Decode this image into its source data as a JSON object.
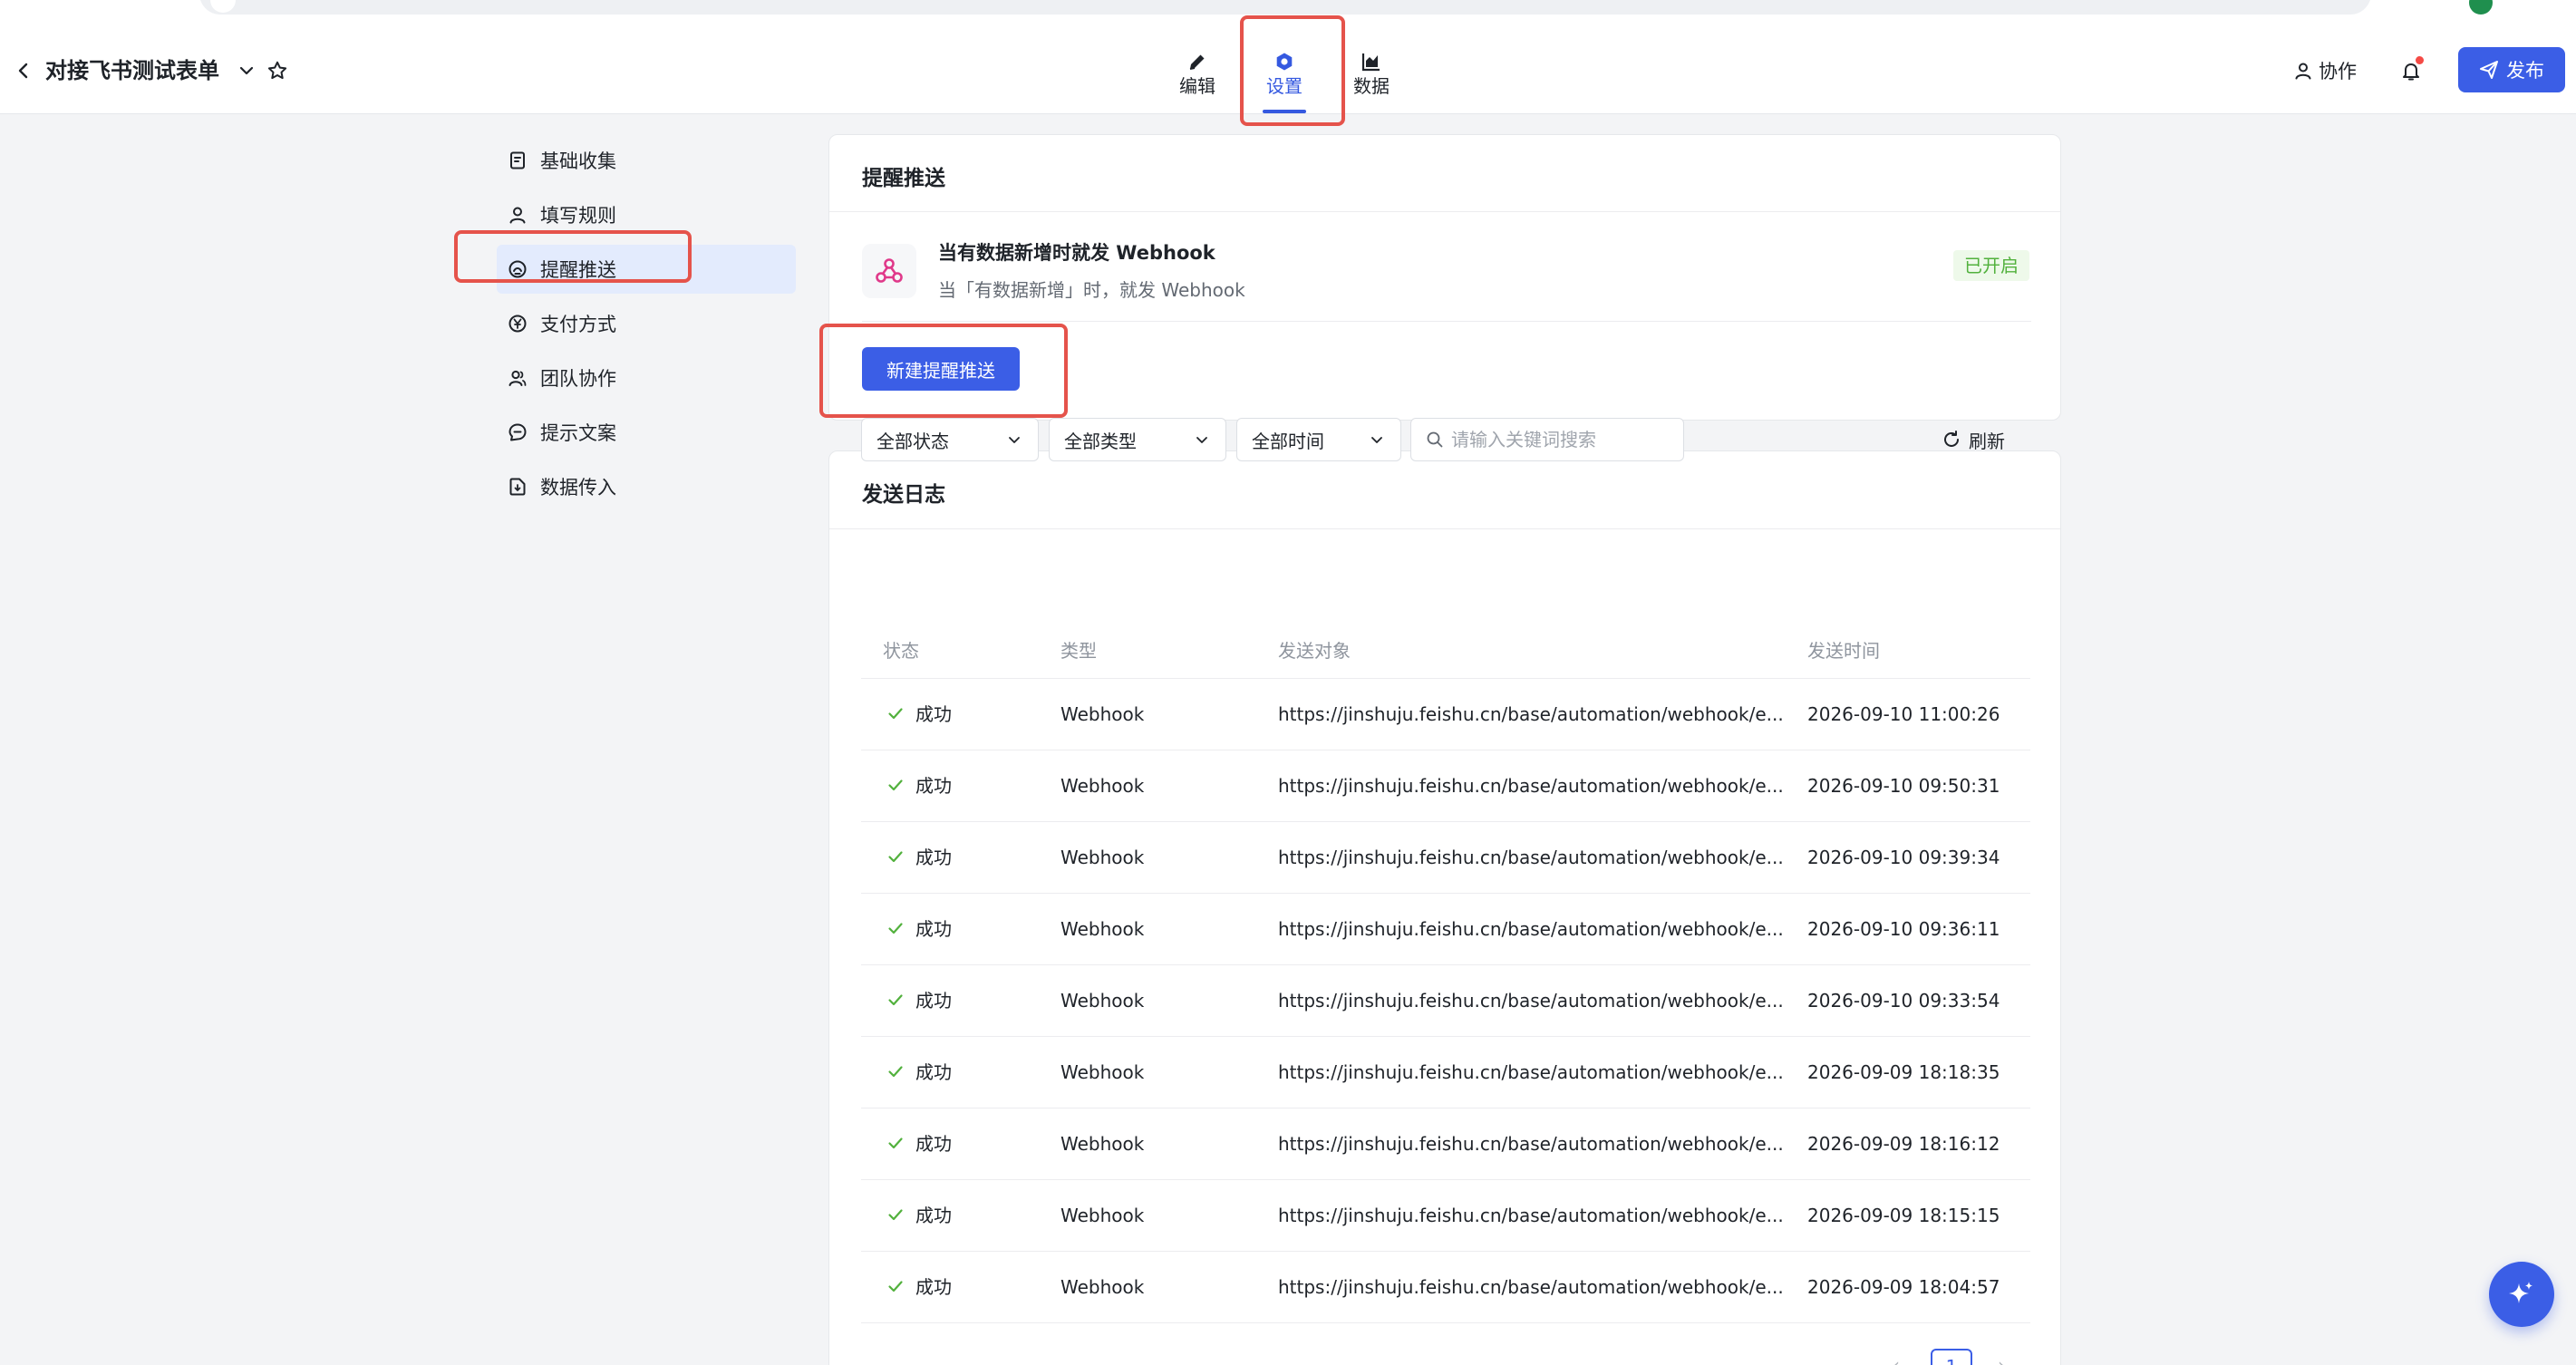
{
  "header": {
    "form_title": "对接飞书测试表单",
    "tabs": [
      {
        "label": "编辑",
        "icon": "pencil-icon"
      },
      {
        "label": "设置",
        "icon": "hexagon-settings-icon",
        "active": true
      },
      {
        "label": "数据",
        "icon": "chart-icon"
      }
    ],
    "collab_label": "协作",
    "publish_label": "发布"
  },
  "sidebar": {
    "items": [
      {
        "label": "基础收集",
        "icon": "form-icon"
      },
      {
        "label": "填写规则",
        "icon": "user-icon"
      },
      {
        "label": "提醒推送",
        "icon": "webhook-icon",
        "active": true
      },
      {
        "label": "支付方式",
        "icon": "yen-icon"
      },
      {
        "label": "团队协作",
        "icon": "team-icon"
      },
      {
        "label": "提示文案",
        "icon": "message-icon"
      },
      {
        "label": "数据传入",
        "icon": "import-icon"
      }
    ]
  },
  "push_card": {
    "title": "提醒推送",
    "hook_title": "当有数据新增时就发 Webhook",
    "hook_desc": "当「有数据新增」时，就发 Webhook",
    "hook_status": "已开启",
    "new_button": "新建提醒推送"
  },
  "log_card": {
    "title": "发送日志",
    "filters": {
      "status": "全部状态",
      "type": "全部类型",
      "time": "全部时间",
      "search_placeholder": "请输入关键词搜索"
    },
    "refresh_label": "刷新",
    "columns": [
      "状态",
      "类型",
      "发送对象",
      "发送时间"
    ],
    "rows": [
      {
        "status": "成功",
        "type": "Webhook",
        "target": "https://jinshuju.feishu.cn/base/automation/webhook/e...",
        "time": "2026-09-10 11:00:26"
      },
      {
        "status": "成功",
        "type": "Webhook",
        "target": "https://jinshuju.feishu.cn/base/automation/webhook/e...",
        "time": "2026-09-10 09:50:31"
      },
      {
        "status": "成功",
        "type": "Webhook",
        "target": "https://jinshuju.feishu.cn/base/automation/webhook/e...",
        "time": "2026-09-10 09:39:34"
      },
      {
        "status": "成功",
        "type": "Webhook",
        "target": "https://jinshuju.feishu.cn/base/automation/webhook/e...",
        "time": "2026-09-10 09:36:11"
      },
      {
        "status": "成功",
        "type": "Webhook",
        "target": "https://jinshuju.feishu.cn/base/automation/webhook/e...",
        "time": "2026-09-10 09:33:54"
      },
      {
        "status": "成功",
        "type": "Webhook",
        "target": "https://jinshuju.feishu.cn/base/automation/webhook/e...",
        "time": "2026-09-09 18:18:35"
      },
      {
        "status": "成功",
        "type": "Webhook",
        "target": "https://jinshuju.feishu.cn/base/automation/webhook/e...",
        "time": "2026-09-09 18:16:12"
      },
      {
        "status": "成功",
        "type": "Webhook",
        "target": "https://jinshuju.feishu.cn/base/automation/webhook/e...",
        "time": "2026-09-09 18:15:15"
      },
      {
        "status": "成功",
        "type": "Webhook",
        "target": "https://jinshuju.feishu.cn/base/automation/webhook/e...",
        "time": "2026-09-09 18:04:57"
      }
    ],
    "pagination": {
      "current": "1"
    }
  },
  "colors": {
    "accent": "#3b5ee6",
    "success": "#52b13d",
    "annotation": "#e5534b"
  }
}
